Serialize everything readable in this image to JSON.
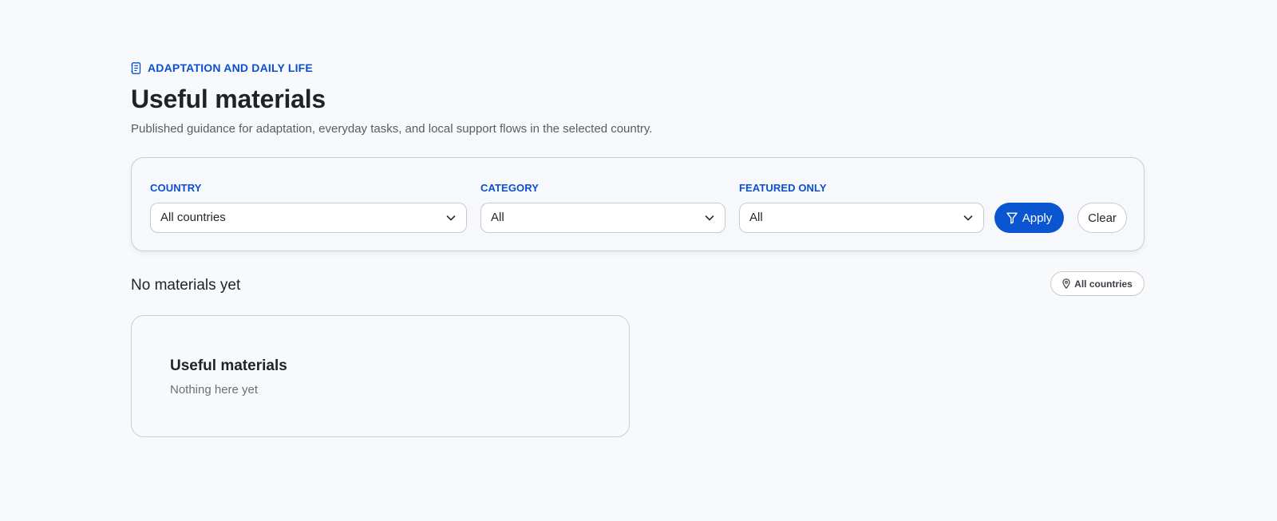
{
  "header": {
    "eyebrow": "ADAPTATION AND DAILY LIFE",
    "eyebrow_icon": "notebook-icon",
    "title": "Useful materials",
    "subtitle": "Published guidance for adaptation, everyday tasks, and local support flows in the selected country."
  },
  "filters": {
    "country": {
      "label": "COUNTRY",
      "selected": "All countries"
    },
    "category": {
      "label": "CATEGORY",
      "selected": "All"
    },
    "featured": {
      "label": "FEATURED ONLY",
      "selected": "All"
    },
    "apply_label": "Apply",
    "apply_icon": "filter-icon",
    "clear_label": "Clear"
  },
  "results": {
    "title": "No materials yet",
    "scope_chip": "All countries",
    "scope_icon": "map-pin-icon"
  },
  "empty_state": {
    "title": "Useful materials",
    "message": "Nothing here yet"
  },
  "colors": {
    "accent": "#0b55d1",
    "background": "#f8f9fb",
    "border": "#c9ced6"
  }
}
